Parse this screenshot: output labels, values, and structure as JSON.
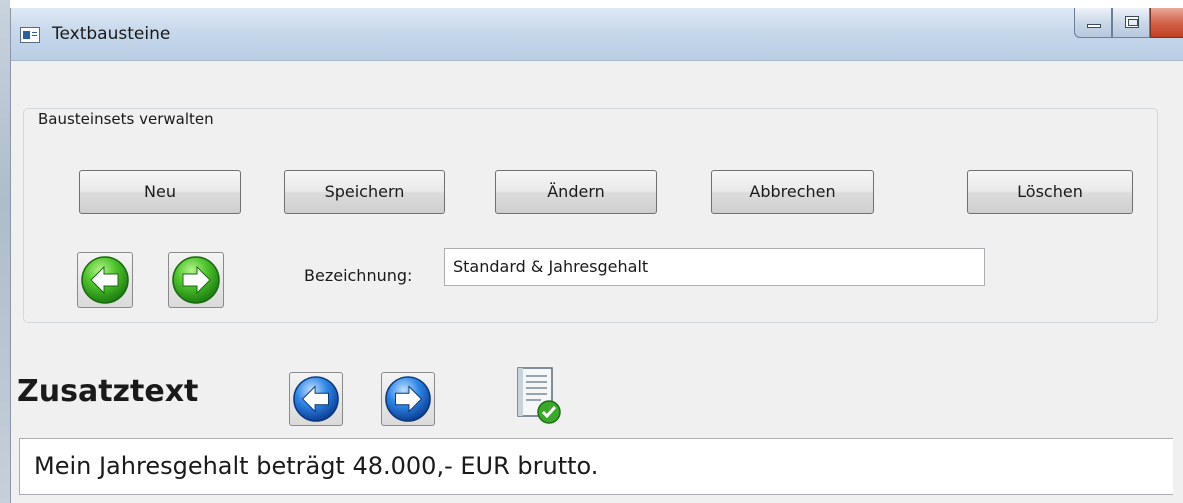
{
  "window": {
    "title": "Textbausteine"
  },
  "group": {
    "label": "Bausteinsets verwalten",
    "buttons": {
      "new": "Neu",
      "save": "Speichern",
      "edit": "Ändern",
      "cancel": "Abbrechen",
      "delete": "Löschen"
    },
    "designation_label": "Bezeichnung:",
    "designation_value": "Standard & Jahresgehalt"
  },
  "extra": {
    "heading": "Zusatztext",
    "text": "Mein Jahresgehalt beträgt 48.000,- EUR brutto."
  },
  "icons": {
    "set_prev": "green-left-arrow-icon",
    "set_next": "green-right-arrow-icon",
    "text_prev": "blue-left-arrow-icon",
    "text_next": "blue-right-arrow-icon",
    "apply": "document-check-icon"
  },
  "colors": {
    "titlebar": "#c7d8eb",
    "nav_green": "#3fae23",
    "nav_blue": "#1f6fd6",
    "close_button": "#c03f22"
  }
}
